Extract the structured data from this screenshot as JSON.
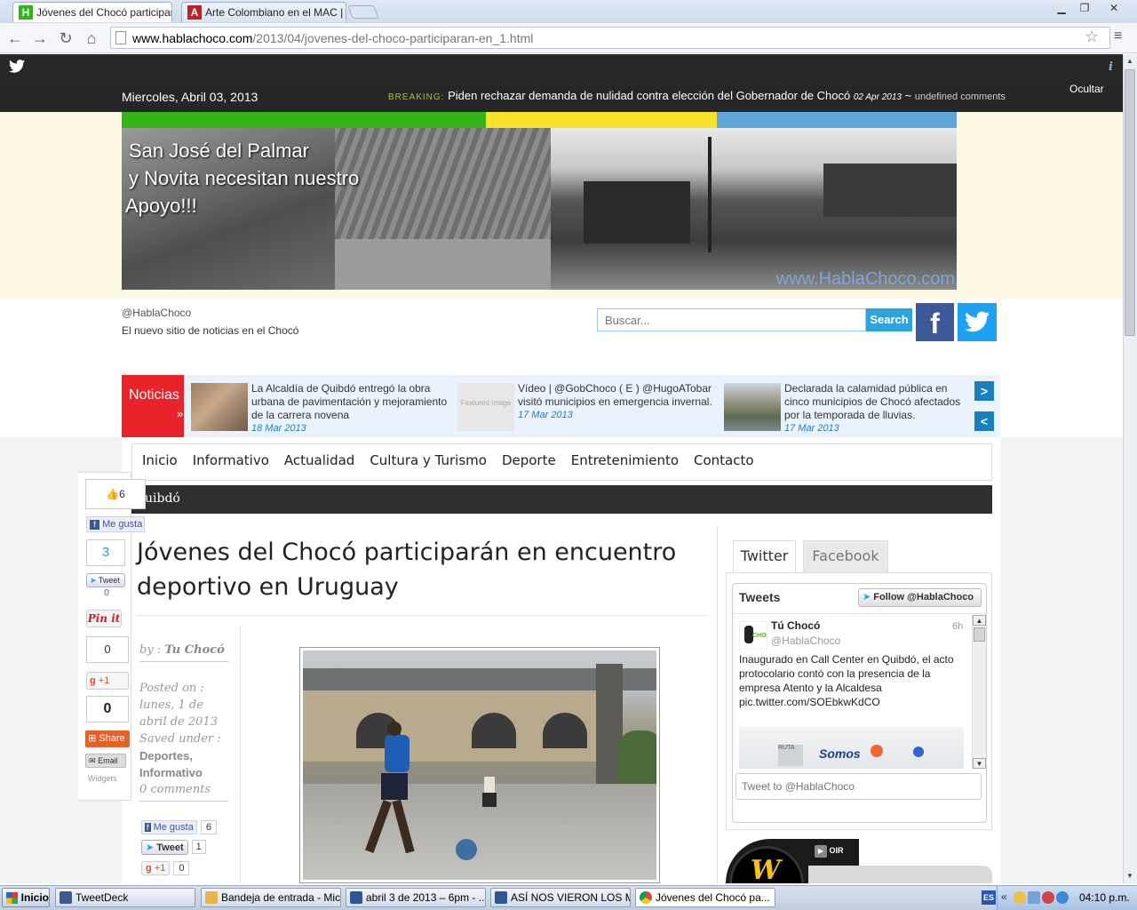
{
  "browser": {
    "tabs": [
      {
        "title": "Jóvenes del Chocó participar",
        "favicon": "H"
      },
      {
        "title": "Arte Colombiano en el MAC |",
        "favicon": "A"
      }
    ],
    "url_host": "www.hablachoco.com",
    "url_path": "/2013/04/jovenes-del-choco-participaran-en_1.html"
  },
  "topbar": {
    "date": "Miercoles, Abril 03, 2013",
    "breaking_label": "BREAKING:",
    "breaking_text": "Piden rechazar demanda de nulidad contra elección del Gobernador de Chocó",
    "breaking_date": "02 Apr 2013",
    "breaking_sep": "~",
    "breaking_comments": "undefined comments",
    "hide_label": "Ocultar",
    "info_glyph": "i"
  },
  "banner": {
    "line1": "San José del Palmar",
    "line2": "y Novita necesitan nuestro",
    "line3": "Apoyo!!!",
    "watermark": "www.HablaChoco.com"
  },
  "site": {
    "handle": "@HablaChoco",
    "tagline": "El nuevo sitio de noticias en el Chocó",
    "search_placeholder": "Buscar...",
    "search_button": "Search"
  },
  "ticker": {
    "label": "Noticias",
    "arrow": "»",
    "items": [
      {
        "text": "La Alcaldía de Quibdó entregó la obra urbana de pavimentación y mejoramiento de la carrera novena",
        "date": "18 Mar 2013"
      },
      {
        "text": "Vídeo | @GobChoco ( E ) @HugoATobar visitó municipios en emergencia invernal.",
        "date": "17 Mar 2013",
        "thumb_text": "Featured Image"
      },
      {
        "text": "Declarada la calamidad pública en cinco municipios de Chocó afectados por la temporada de lluvias.",
        "date": "17 Mar 2013"
      }
    ],
    "next": ">",
    "prev": "<"
  },
  "nav": {
    "items": [
      "Inicio",
      "Informativo",
      "Actualidad",
      "Cultura y Turismo",
      "Deporte",
      "Entretenimiento",
      "Contacto"
    ],
    "sub": "uibdó"
  },
  "share": {
    "like_count": "6",
    "like_label": "Me gusta",
    "tweet_count": "3",
    "tweet_label": "Tweet",
    "pin_count": "0",
    "pin_label": "Pin it",
    "gplus_count": "0",
    "gplus_label": "+1",
    "share_count": "0",
    "share_label": "Share",
    "email_label": "Email",
    "widgets_label": "Widgets"
  },
  "article": {
    "title": "Jóvenes del Chocó participarán en encuentro deportivo en Uruguay",
    "by_label": "by :",
    "author": "Tu Chocó",
    "posted_label": "Posted on :",
    "posted_date": "lunes, 1 de abril de 2013",
    "saved_label": "Saved under :",
    "category1": "Deportes,",
    "category2": "Informativo",
    "comments": "0 comments",
    "fb_like": "Me gusta",
    "fb_count": "6",
    "tw_label": "Tweet",
    "tw_count": "1",
    "gp_label": "+1",
    "gp_count": "0"
  },
  "sidebar": {
    "tab_twitter": "Twitter",
    "tab_facebook": "Facebook",
    "widget_title": "Tweets",
    "follow": "Follow @HablaChoco",
    "tweet_name": "Tú Chocó",
    "tweet_handle": "@HablaChoco",
    "tweet_time": "6h",
    "tweet_text": "Inaugurado en Call Center en Quibdó, el acto protocolario contó con la presencia de la empresa Atento y la Alcaldesa",
    "tweet_link": "pic.twitter.com/SOEbkwKdCO",
    "compose_placeholder": "Tweet to @HablaChoco",
    "radio_label": "OIR"
  },
  "taskbar": {
    "start": "Inicio",
    "items": [
      "TweetDeck",
      "Bandeja de entrada - Mic...",
      "abril 3 de 2013 – 6pm - ...",
      "ASÍ NOS VIERON LOS M...",
      "Jóvenes del Chocó pa..."
    ],
    "lang": "ES",
    "clock": "04:10 p.m."
  },
  "colors": {
    "green": "#33b51a",
    "yellow": "#f8e22e",
    "blue": "#5fa6dc",
    "red": "#e8232a",
    "fb": "#3b5998",
    "tw": "#1da1f2"
  }
}
